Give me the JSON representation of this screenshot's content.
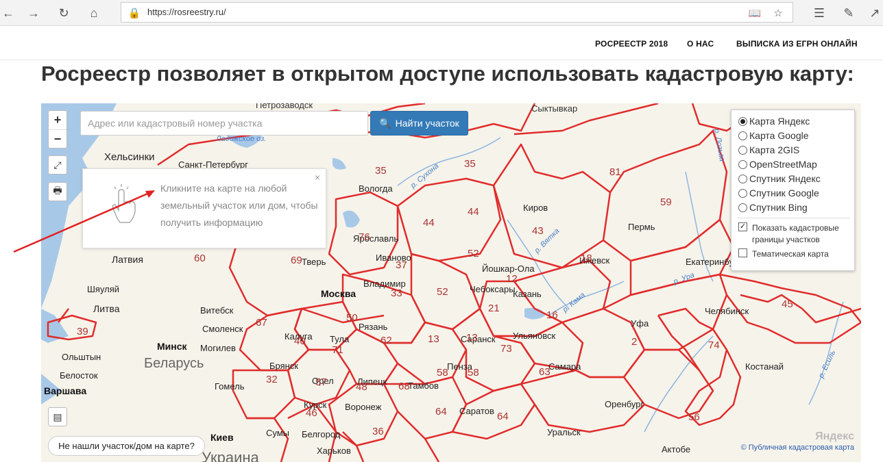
{
  "browser": {
    "url": "https://rosreestry.ru/"
  },
  "site_nav": {
    "items": [
      "РОСРЕЕСТР 2018",
      "О НАС",
      "ВЫПИСКА ИЗ ЕГРН ОНЛАЙН"
    ]
  },
  "page": {
    "title": "Росреестр позволяет в открытом доступе использовать кадастровую карту:"
  },
  "map": {
    "search_placeholder": "Адрес или кадастровый номер участка",
    "search_button": "Найти участок",
    "zoom_in": "+",
    "zoom_out": "−",
    "info_popup": "Кликните на карте на любой земельный участок или дом, чтобы получить информацию",
    "info_close": "×",
    "layers": {
      "base": [
        {
          "label": "Карта Яндекс",
          "selected": true
        },
        {
          "label": "Карта Google",
          "selected": false
        },
        {
          "label": "Карта 2GIS",
          "selected": false
        },
        {
          "label": "OpenStreetMap",
          "selected": false
        },
        {
          "label": "Спутник Яндекс",
          "selected": false
        },
        {
          "label": "Спутник Google",
          "selected": false
        },
        {
          "label": "Спутник Bing",
          "selected": false
        }
      ],
      "show_cadastral": {
        "label": "Показать кадастровые границы участков",
        "checked": true
      },
      "thematic": {
        "label": "Тематическая карта",
        "checked": false
      }
    },
    "not_found": "Не нашли участок/дом на карте?",
    "attribution": "© Публичная кадастровая карта",
    "yandex_mark": "Яндекс",
    "cities": [
      {
        "name": "Петрозаводск"
      },
      {
        "name": "Сыктывкар"
      },
      {
        "name": "Хельсинки"
      },
      {
        "name": "Санкт-Петербург"
      },
      {
        "name": "Вологда"
      },
      {
        "name": "Киров"
      },
      {
        "name": "Пермь"
      },
      {
        "name": "Ярославль"
      },
      {
        "name": "Иваново"
      },
      {
        "name": "Ижевск"
      },
      {
        "name": "Екатеринбург"
      },
      {
        "name": "Латвия"
      },
      {
        "name": "Тверь"
      },
      {
        "name": "Йошкар-Ола"
      },
      {
        "name": "Шяуляй"
      },
      {
        "name": "Владимир"
      },
      {
        "name": "Чебоксары"
      },
      {
        "name": "Казань"
      },
      {
        "name": "Москва"
      },
      {
        "name": "Литва"
      },
      {
        "name": "Витебск"
      },
      {
        "name": "Уфа"
      },
      {
        "name": "Челябинск"
      },
      {
        "name": "Смоленск"
      },
      {
        "name": "Рязань"
      },
      {
        "name": "Калуга"
      },
      {
        "name": "Тула"
      },
      {
        "name": "Саранск"
      },
      {
        "name": "Ульяновск"
      },
      {
        "name": "Минск"
      },
      {
        "name": "Ольштын"
      },
      {
        "name": "Могилев"
      },
      {
        "name": "Беларусь"
      },
      {
        "name": "Брянск"
      },
      {
        "name": "Белосток"
      },
      {
        "name": "Пенза"
      },
      {
        "name": "Самара"
      },
      {
        "name": "Костанай"
      },
      {
        "name": "Орел"
      },
      {
        "name": "Липецк"
      },
      {
        "name": "Тамбов"
      },
      {
        "name": "Варшава"
      },
      {
        "name": "Гомель"
      },
      {
        "name": "Курск"
      },
      {
        "name": "Воронеж"
      },
      {
        "name": "Саратов"
      },
      {
        "name": "Оренбург"
      },
      {
        "name": "Сумы"
      },
      {
        "name": "Белгород"
      },
      {
        "name": "Киев"
      },
      {
        "name": "Уральск"
      },
      {
        "name": "Харьков"
      },
      {
        "name": "Актобе"
      },
      {
        "name": "Украина"
      },
      {
        "name": "Ладожское оз."
      }
    ],
    "rivers": [
      "р. Сухона",
      "р. Вятка",
      "р. Кама",
      "р. Лозьва",
      "р. Есиль",
      "р. Ура"
    ],
    "regions": [
      "35",
      "35",
      "81",
      "59",
      "44",
      "44",
      "43",
      "76",
      "37",
      "52",
      "12",
      "18",
      "69",
      "60",
      "33",
      "52",
      "21",
      "16",
      "50",
      "67",
      "39",
      "40",
      "71",
      "62",
      "13",
      "13",
      "73",
      "2",
      "74",
      "45",
      "32",
      "57",
      "48",
      "68",
      "58",
      "58",
      "63",
      "46",
      "64",
      "64",
      "56",
      "36"
    ]
  },
  "colors": {
    "region_border": "#e02c2c",
    "water": "#a8c8e8",
    "land": "#f6f3ea",
    "accent_button": "#337ab7"
  }
}
